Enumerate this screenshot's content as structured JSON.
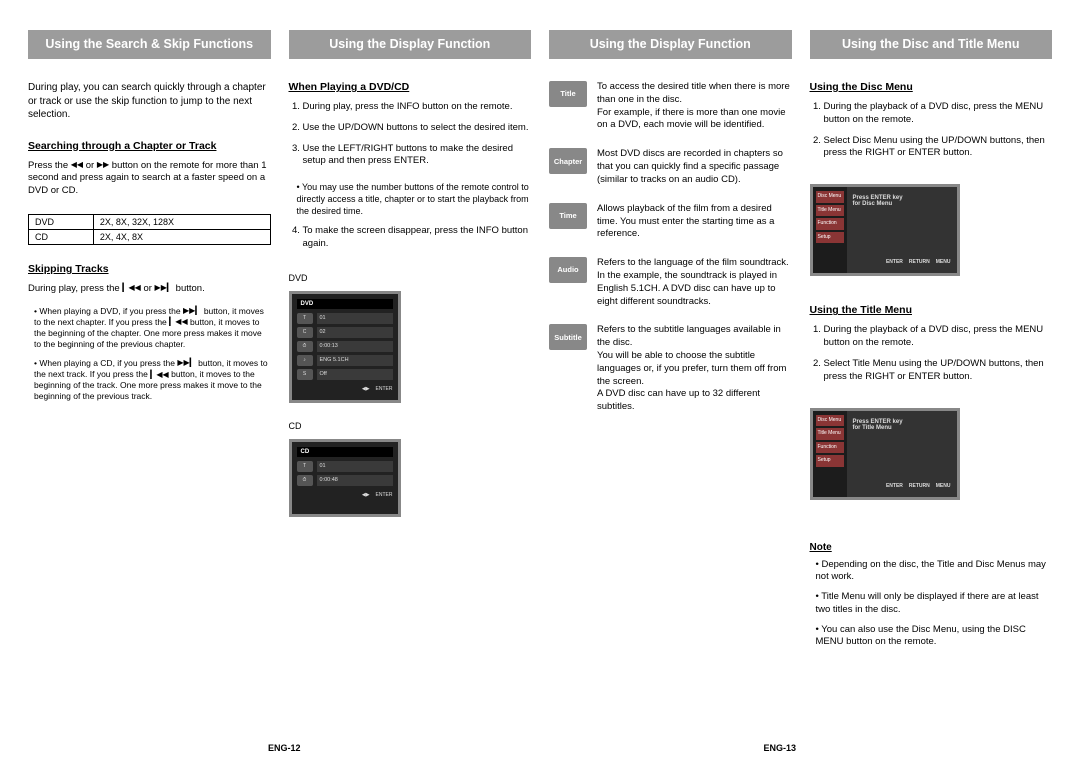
{
  "headers": {
    "col1": "Using the Search & Skip Functions",
    "col2": "Using the Display Function",
    "col3": "Using the Display Function",
    "col4": "Using the Disc and Title Menu"
  },
  "col1": {
    "intro": "During play, you can search quickly through a chapter or track or use the skip function to jump to the next selection.",
    "search_title": "Searching through a Chapter or Track",
    "search_body_a": "Press the",
    "search_body_b": "or",
    "search_body_c": "button on the remote for more than 1 second and press again to search at a faster speed on a DVD or CD.",
    "table": {
      "r1c1": "DVD",
      "r1c2": "2X, 8X, 32X, 128X",
      "r2c1": "CD",
      "r2c2": "2X, 4X, 8X"
    },
    "skip_title": "Skipping Tracks",
    "skip_body_a": "During play, press the",
    "skip_body_b": "or",
    "skip_body_c": "button.",
    "note1_a": "When playing a DVD, if you press the",
    "note1_b": "button, it moves to the next chapter. If you press the",
    "note1_c": "button, it moves to the beginning of the chapter. One more press makes it move to the beginning of the previous chapter.",
    "note2_a": "When playing a CD, if you press the",
    "note2_b": "button, it moves to the next track. If you press the",
    "note2_c": "button, it moves to the beginning of the track. One more press makes it move to the beginning of the previous track."
  },
  "col2": {
    "title": "When Playing a DVD/CD",
    "steps": [
      "During play, press the INFO button on the remote.",
      "Use the UP/DOWN buttons to select the desired item.",
      "Use the LEFT/RIGHT buttons to make the desired setup and then press ENTER.",
      "To make the screen disappear, press the INFO button again."
    ],
    "sub_bullet": "• You may use the number buttons of the remote control to directly access a title, chapter or to start the playback from the desired time.",
    "label_dvd": "DVD",
    "label_cd": "CD",
    "dvd_shot": {
      "header": "DVD",
      "rows": [
        {
          "icon": "T",
          "val": "01"
        },
        {
          "icon": "C",
          "val": "02"
        },
        {
          "icon": "⏱",
          "val": "0:00:13"
        },
        {
          "icon": "♪",
          "val": "ENG 5.1CH"
        },
        {
          "icon": "S",
          "val": "Off"
        }
      ],
      "footer_a": "◀▶",
      "footer_b": "ENTER"
    },
    "cd_shot": {
      "header": "CD",
      "rows": [
        {
          "icon": "T",
          "val": "01"
        },
        {
          "icon": "⏱",
          "val": "0:00:48"
        }
      ],
      "footer_a": "◀▶",
      "footer_b": "ENTER"
    }
  },
  "col3": {
    "defs": {
      "title": {
        "badge": "Title",
        "text": "To access the desired title when there is more than one in the disc.\nFor example, if there is more than one movie on a DVD, each movie will be identified."
      },
      "chapter": {
        "badge": "Chapter",
        "text": "Most DVD discs are recorded in chapters so that you can quickly find a specific passage (similar to tracks on an audio CD)."
      },
      "time": {
        "badge": "Time",
        "text": "Allows playback of the film from a desired time. You must enter the starting time as a reference."
      },
      "audio": {
        "badge": "Audio",
        "text": "Refers to the language of the film soundtrack. In the example, the soundtrack is played in English 5.1CH. A DVD disc can have up to eight different soundtracks."
      },
      "subtitle": {
        "badge": "Subtitle",
        "text": "Refers to the subtitle languages available in the disc.\nYou will be able to choose the subtitle languages or, if you prefer, turn them off from the screen.\nA DVD disc can have up to 32 different subtitles."
      }
    }
  },
  "col4": {
    "disc_title": "Using the Disc Menu",
    "disc_steps": [
      "During the playback of a DVD disc, press the MENU button on the remote.",
      "Select Disc Menu using the UP/DOWN buttons, then press the RIGHT or ENTER button."
    ],
    "disc_shot": {
      "tabs": [
        "Disc Menu",
        "Title Menu",
        "Function",
        "Setup"
      ],
      "main": "Press ENTER key\nfor Disc Menu",
      "footer": [
        "ENTER",
        "RETURN",
        "MENU"
      ]
    },
    "title_title": "Using the Title Menu",
    "title_steps": [
      "During the playback of a DVD disc, press the MENU button on the remote.",
      "Select Title Menu using the UP/DOWN buttons, then press the RIGHT or ENTER button."
    ],
    "title_shot": {
      "tabs": [
        "Disc Menu",
        "Title Menu",
        "Function",
        "Setup"
      ],
      "main": "Press ENTER key\nfor Title Menu",
      "footer": [
        "ENTER",
        "RETURN",
        "MENU"
      ]
    },
    "note_heading": "Note",
    "notes": [
      "Depending on the disc, the Title and Disc Menus may not work.",
      "Title Menu will only be displayed if there are at least two titles in the disc.",
      "You can also use the Disc Menu, using the DISC MENU button on the remote."
    ]
  },
  "pagenums": {
    "left": "ENG-12",
    "right": "ENG-13"
  },
  "icons": {
    "rew": "◀◀",
    "fwd": "▶▶",
    "prev": "▎◀◀",
    "next": "▶▶▎"
  }
}
